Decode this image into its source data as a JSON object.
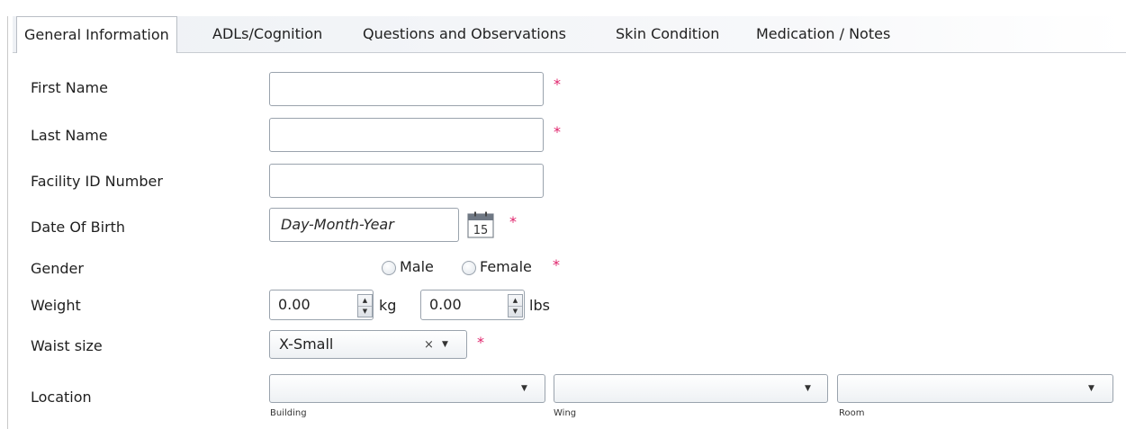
{
  "tabs": [
    {
      "label": "General Information",
      "active": true
    },
    {
      "label": "ADLs/Cognition",
      "active": false
    },
    {
      "label": "Questions and Observations",
      "active": false
    },
    {
      "label": "Skin Condition",
      "active": false
    },
    {
      "label": "Medication / Notes",
      "active": false
    }
  ],
  "form": {
    "first_name": {
      "label": "First Name",
      "value": "",
      "required": "*"
    },
    "last_name": {
      "label": "Last Name",
      "value": "",
      "required": "*"
    },
    "facility_id": {
      "label": "Facility ID Number",
      "value": ""
    },
    "dob": {
      "label": "Date Of Birth",
      "placeholder": "Day-Month-Year",
      "calendar_day": "15",
      "required": "*"
    },
    "gender": {
      "label": "Gender",
      "options": [
        "Male",
        "Female"
      ],
      "selected": "",
      "required": "*"
    },
    "weight": {
      "label": "Weight",
      "kg_value": "0.00",
      "kg_unit": "kg",
      "lbs_value": "0.00",
      "lbs_unit": "lbs"
    },
    "waist": {
      "label": "Waist size",
      "value": "X-Small",
      "clear": "×",
      "required": "*"
    },
    "location": {
      "label": "Location",
      "building_caption": "Building",
      "wing_caption": "Wing",
      "room_caption": "Room"
    }
  },
  "icons": {
    "calendar": "calendar-icon",
    "dropdown": "chevron-down-icon",
    "spin_up": "▲",
    "spin_down": "▼"
  },
  "colors": {
    "required": "#e0226b",
    "border": "#9aa3ad",
    "tab_bar": "#eef1f5"
  }
}
